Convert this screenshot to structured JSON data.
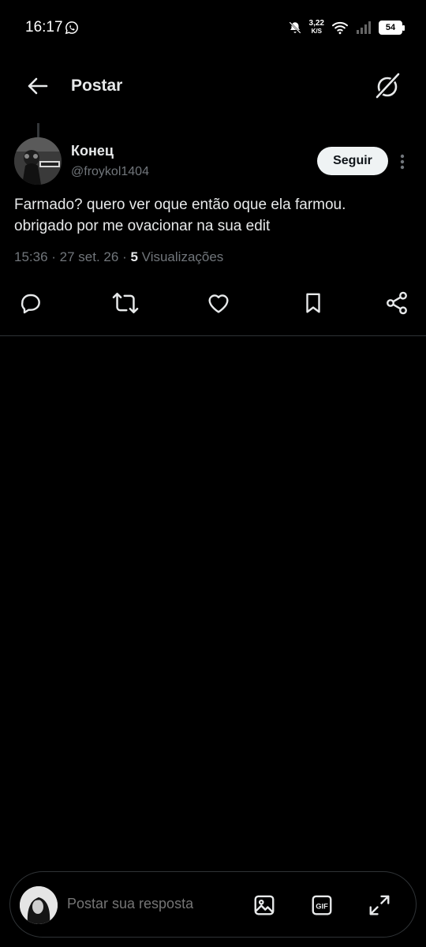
{
  "status_bar": {
    "time": "16:17",
    "speed_value": "3,22",
    "speed_unit": "K/S",
    "battery": "54"
  },
  "header": {
    "title": "Postar"
  },
  "post": {
    "author_name": "Конец",
    "author_handle": "@froykol1404",
    "follow_label": "Seguir",
    "text_line1": "Farmado? quero ver oque então oque ela farmou.",
    "text_line2": "obrigado por me ovacionar na sua edit",
    "time": "15:36",
    "date": "27 set. 26",
    "views_count": "5",
    "views_label": "Visualizações"
  },
  "reply": {
    "placeholder": "Postar sua resposta"
  },
  "icons": {
    "back": "arrow-left-icon",
    "grok": "grok-icon",
    "reply": "reply-icon",
    "repost": "repost-icon",
    "like": "heart-icon",
    "bookmark": "bookmark-icon",
    "share": "share-icon",
    "image": "image-icon",
    "gif": "gif-icon",
    "expand": "expand-icon"
  },
  "colors": {
    "background": "#000000",
    "text_primary": "#e7e9ea",
    "text_secondary": "#71767b",
    "follow_bg": "#eff3f4"
  }
}
